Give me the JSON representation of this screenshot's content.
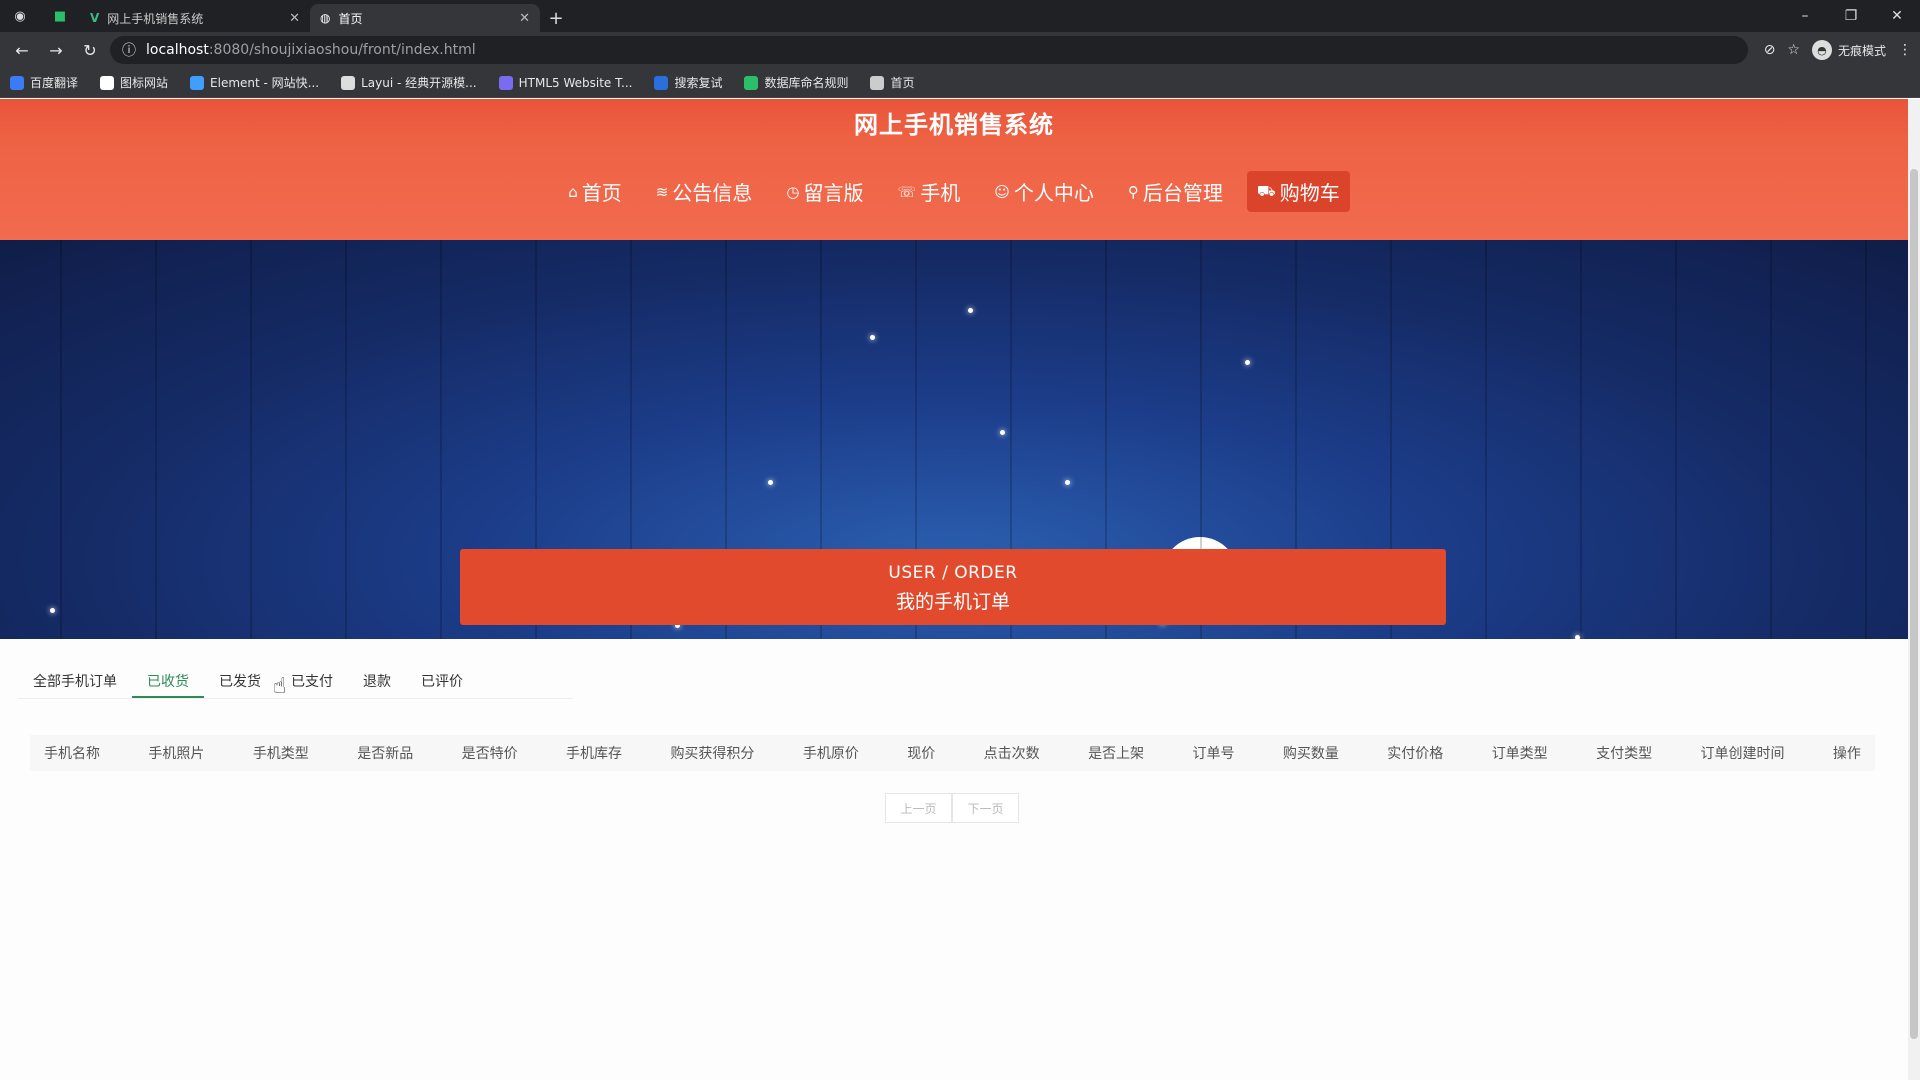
{
  "browser": {
    "tabs": [
      {
        "label": "网上手机销售系统",
        "active": false
      },
      {
        "label": "首页",
        "active": true
      }
    ],
    "url_host": "localhost",
    "url_path": ":8080/shoujixiaoshou/front/index.html",
    "profile_label": "无痕模式",
    "bookmarks": [
      {
        "label": "百度翻译",
        "color": "#3b7bf5"
      },
      {
        "label": "图标网站",
        "color": "#ffffff"
      },
      {
        "label": "Element - 网站快...",
        "color": "#409eff"
      },
      {
        "label": "Layui - 经典开源模...",
        "color": "#dddddd"
      },
      {
        "label": "HTML5 Website T...",
        "color": "#7a6cf0"
      },
      {
        "label": "搜索复试",
        "color": "#2a6fdb"
      },
      {
        "label": "数据库命名规则",
        "color": "#2bbf6a"
      },
      {
        "label": "首页",
        "color": "#cccccc"
      }
    ]
  },
  "site": {
    "title": "网上手机销售系统",
    "nav": [
      {
        "label": "首页",
        "icon": "home-icon",
        "glyph": "⌂",
        "active": false
      },
      {
        "label": "公告信息",
        "icon": "list-icon",
        "glyph": "≋",
        "active": false
      },
      {
        "label": "留言版",
        "icon": "clock-icon",
        "glyph": "◷",
        "active": false
      },
      {
        "label": "手机",
        "icon": "phone-icon",
        "glyph": "☏",
        "active": false
      },
      {
        "label": "个人中心",
        "icon": "user-icon",
        "glyph": "☺",
        "active": false
      },
      {
        "label": "后台管理",
        "icon": "link-icon",
        "glyph": "⚲",
        "active": false
      },
      {
        "label": "购物车",
        "icon": "cart-icon",
        "glyph": "⛟",
        "active": true
      }
    ],
    "accent": "#e24a2e"
  },
  "order": {
    "title_en": "USER / ORDER",
    "title_cn": "我的手机订单",
    "tabs": [
      {
        "label": "全部手机订单",
        "active": false
      },
      {
        "label": "已收货",
        "active": true
      },
      {
        "label": "已发货",
        "active": false
      },
      {
        "label": "已支付",
        "active": false
      },
      {
        "label": "退款",
        "active": false
      },
      {
        "label": "已评价",
        "active": false
      }
    ],
    "columns": [
      "手机名称",
      "手机照片",
      "手机类型",
      "是否新品",
      "是否特价",
      "手机库存",
      "购买获得积分",
      "手机原价",
      "现价",
      "点击次数",
      "是否上架",
      "订单号",
      "购买数量",
      "实付价格",
      "订单类型",
      "支付类型",
      "订单创建时间",
      "操作"
    ],
    "pager": {
      "prev": "上一页",
      "next": "下一页"
    }
  }
}
